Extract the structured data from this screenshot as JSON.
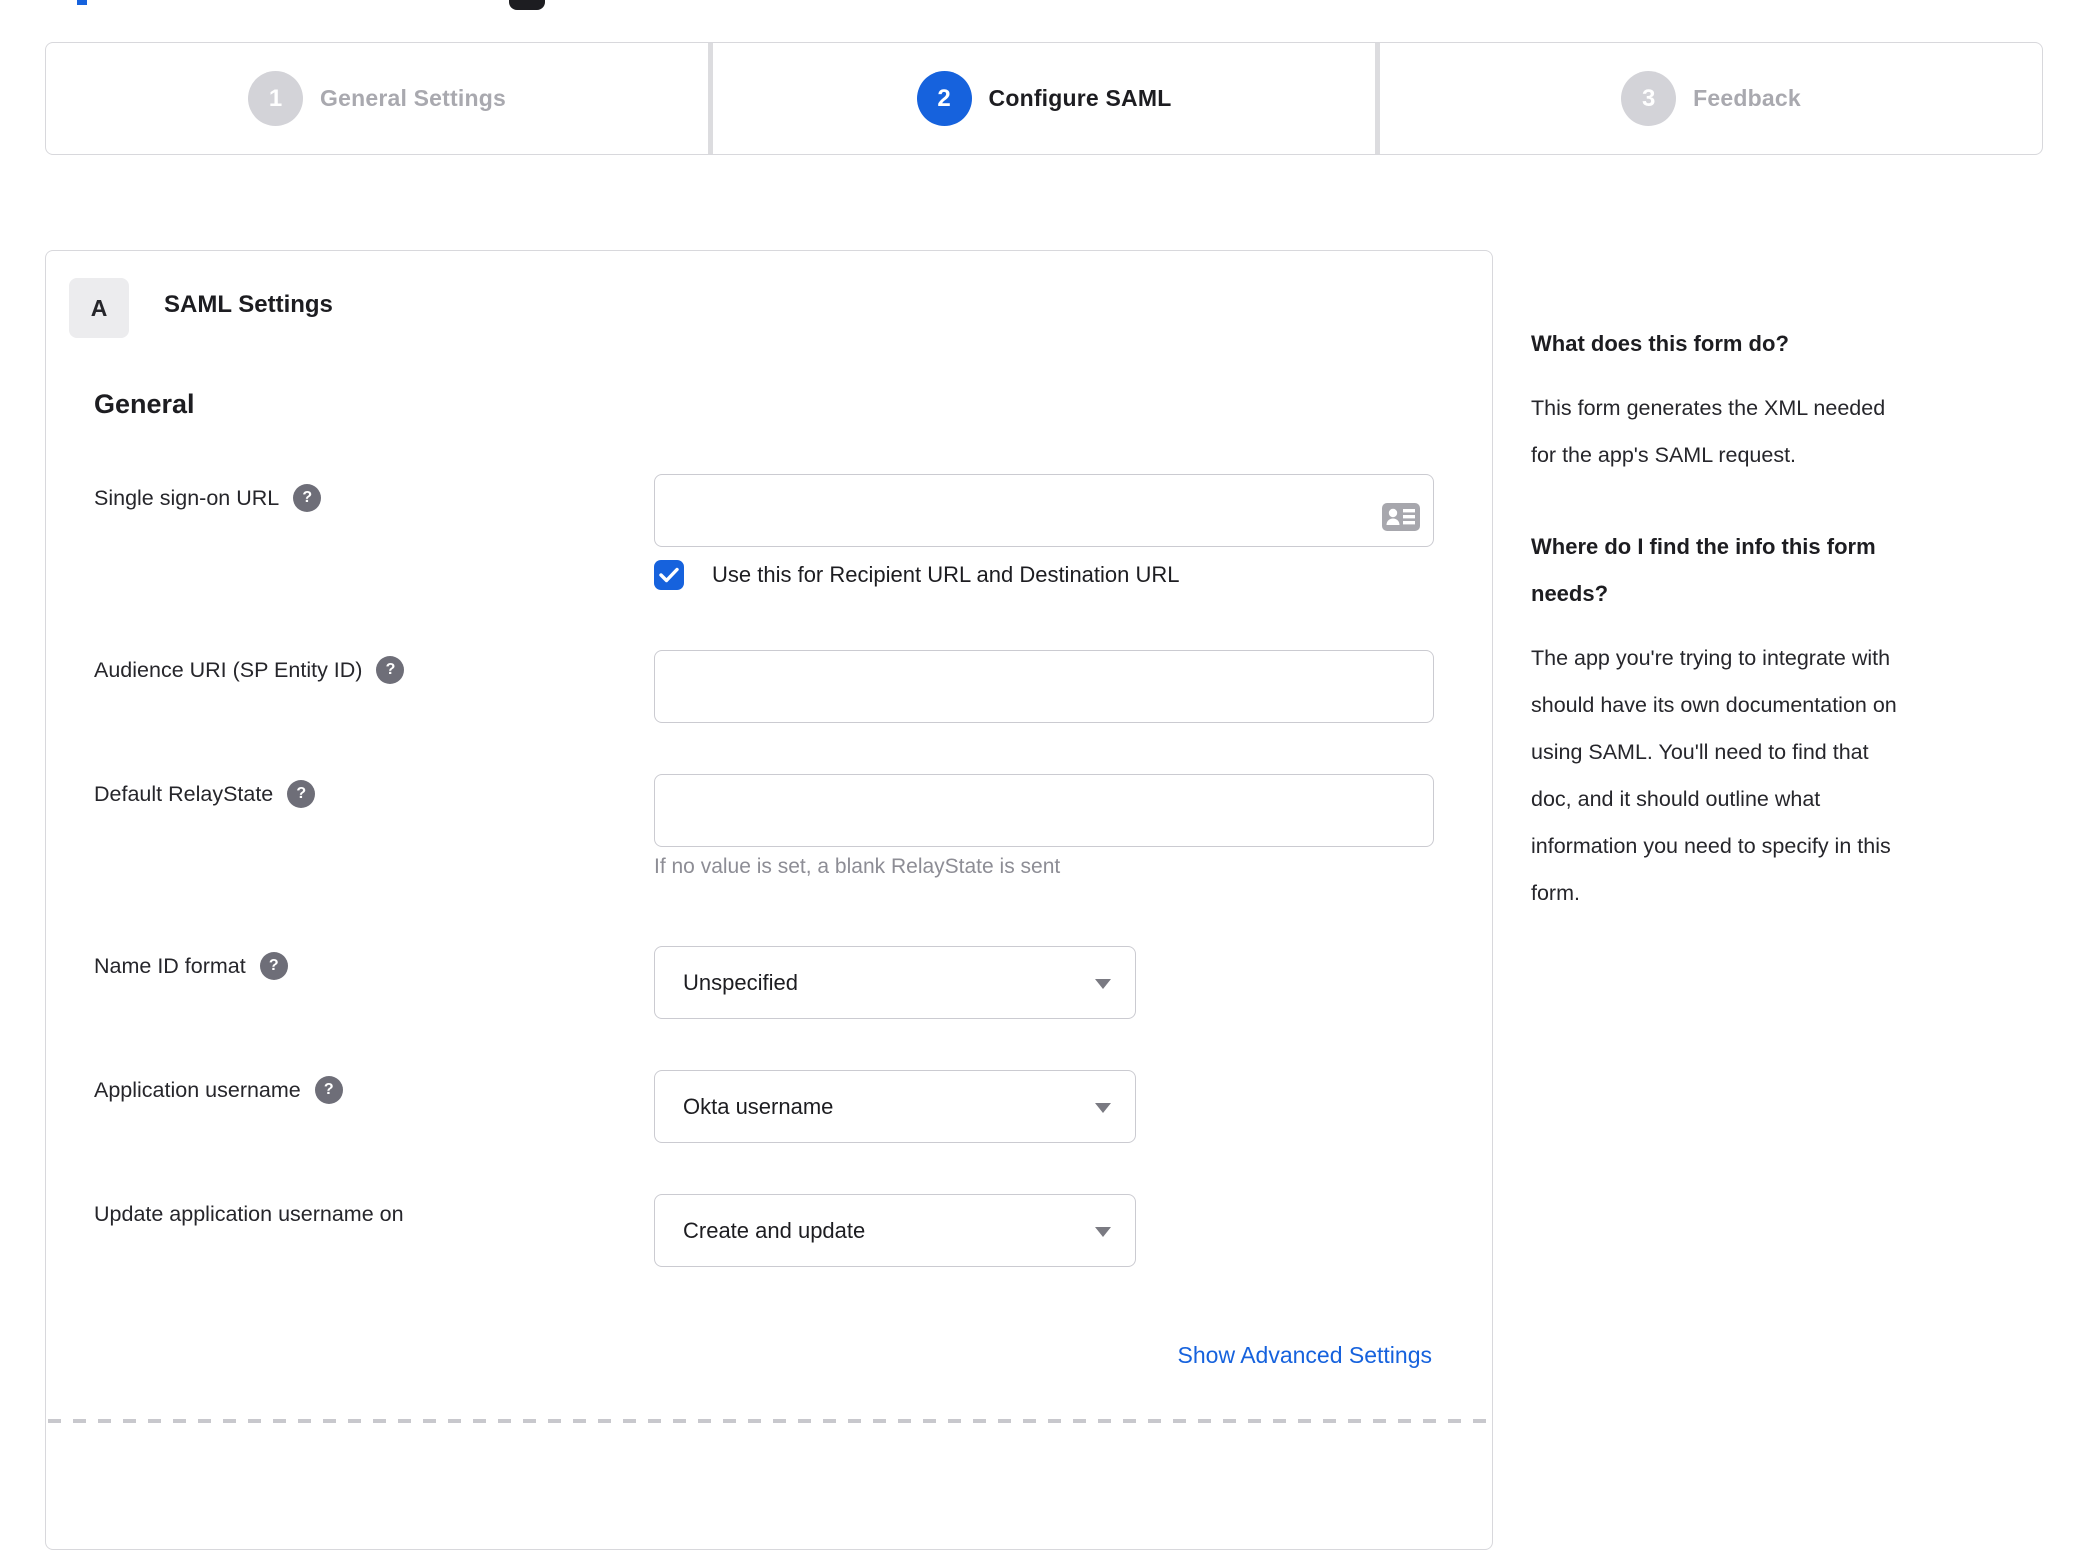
{
  "colors": {
    "accent_blue": "#1662dd",
    "border_grey": "#d8d8dc",
    "inactive_grey": "#a9a9af",
    "help_icon_grey": "#6e6e78",
    "hint_grey": "#8d8d95",
    "text_dark": "#1d1d21"
  },
  "stepper": {
    "steps": [
      {
        "number": "1",
        "label": "General Settings",
        "state": "inactive"
      },
      {
        "number": "2",
        "label": "Configure SAML",
        "state": "active"
      },
      {
        "number": "3",
        "label": "Feedback",
        "state": "inactive"
      }
    ]
  },
  "panel": {
    "badge": "A",
    "title": "SAML Settings",
    "section_heading": "General",
    "fields": [
      {
        "label": "Single sign-on URL",
        "has_help": true,
        "type": "text",
        "value": "",
        "checkbox": {
          "checked": true,
          "label": "Use this for Recipient URL and Destination URL"
        }
      },
      {
        "label": "Audience URI (SP Entity ID)",
        "has_help": true,
        "type": "text",
        "value": ""
      },
      {
        "label": "Default RelayState",
        "has_help": true,
        "type": "text",
        "value": "",
        "hint": "If no value is set, a blank RelayState is sent"
      },
      {
        "label": "Name ID format",
        "has_help": true,
        "type": "select",
        "value": "Unspecified"
      },
      {
        "label": "Application username",
        "has_help": true,
        "type": "select",
        "value": "Okta username"
      },
      {
        "label": "Update application username on",
        "has_help": false,
        "type": "select",
        "value": "Create and update"
      }
    ],
    "help_icon_glyph": "?",
    "advanced_link": "Show Advanced Settings"
  },
  "sidebar": {
    "sections": [
      {
        "heading_lines": [
          "What does this form do?"
        ],
        "body_lines": [
          "This form generates the XML needed",
          "for the app's SAML request."
        ]
      },
      {
        "heading_lines": [
          "Where do I find the info this form",
          "needs?"
        ],
        "body_lines": [
          "The app you're trying to integrate with",
          "should have its own documentation on",
          "using SAML. You'll need to find that",
          "doc, and it should outline what",
          "information you need to specify in this",
          "form."
        ]
      }
    ]
  }
}
